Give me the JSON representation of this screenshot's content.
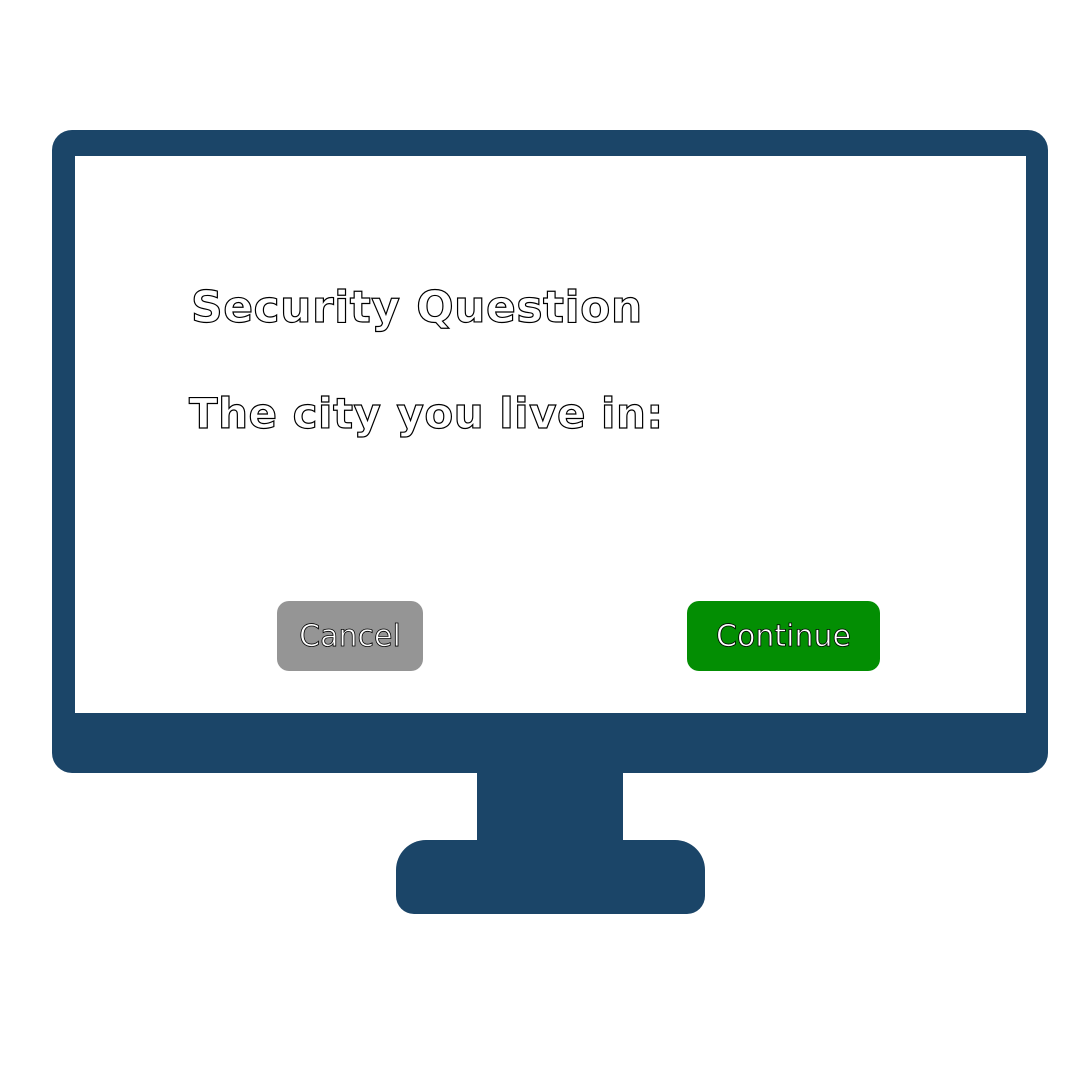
{
  "dialog": {
    "title": "Security Question",
    "question": "The city you live in:"
  },
  "buttons": {
    "cancel_label": "Cancel",
    "continue_label": "Continue"
  },
  "colors": {
    "monitor": "#1b4568",
    "cancel_button": "#959595",
    "continue_button": "#038e03",
    "screen": "#ffffff"
  },
  "icons": [
    "monitor-icon"
  ]
}
